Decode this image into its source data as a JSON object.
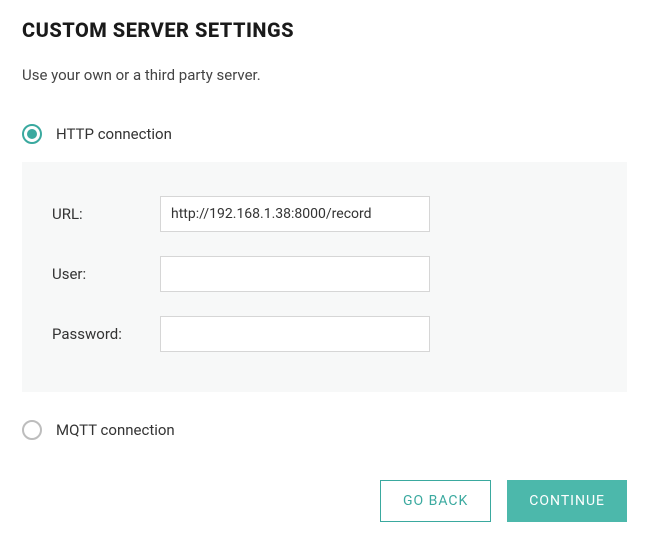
{
  "title": "CUSTOM SERVER SETTINGS",
  "subtitle": "Use your own or a third party server.",
  "options": {
    "http": {
      "label": "HTTP connection",
      "selected": true
    },
    "mqtt": {
      "label": "MQTT connection",
      "selected": false
    }
  },
  "form": {
    "url_label": "URL:",
    "url_value": "http://192.168.1.38:8000/record",
    "user_label": "User:",
    "user_value": "",
    "password_label": "Password:",
    "password_value": ""
  },
  "buttons": {
    "back": "GO BACK",
    "continue": "CONTINUE"
  }
}
